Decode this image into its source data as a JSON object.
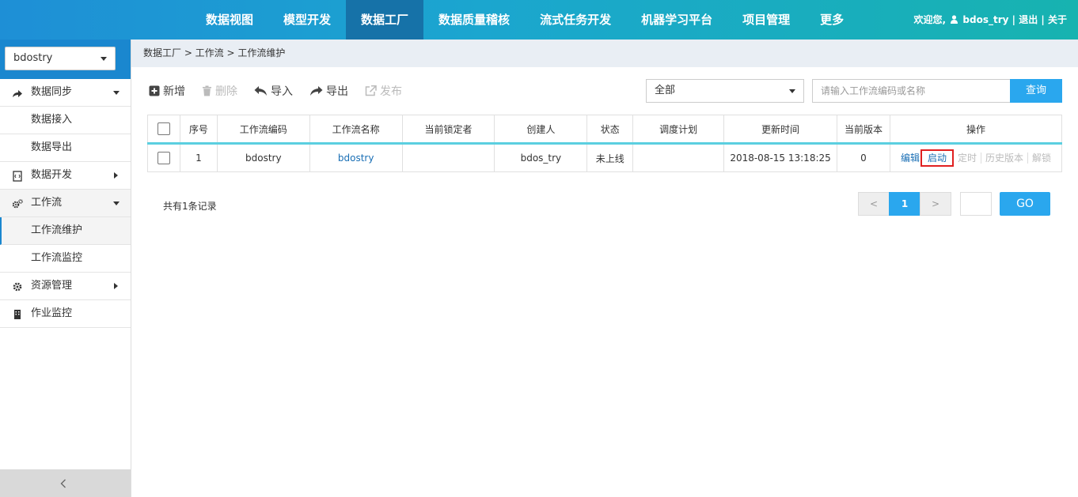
{
  "topnav": {
    "items": [
      "数据视图",
      "模型开发",
      "数据工厂",
      "数据质量稽核",
      "流式任务开发",
      "机器学习平台",
      "项目管理",
      "更多"
    ],
    "active_index": 2
  },
  "user": {
    "welcome": "欢迎您,",
    "name": "bdos_try",
    "logout": "退出",
    "about": "关于",
    "sep": "|"
  },
  "sidebar": {
    "project": "bdostry",
    "items": [
      {
        "label": "数据同步",
        "icon": "share-arrow-icon"
      },
      {
        "label": "数据接入"
      },
      {
        "label": "数据导出"
      },
      {
        "label": "数据开发",
        "icon": "code-file-icon"
      },
      {
        "label": "工作流",
        "icon": "gears-icon"
      },
      {
        "label": "工作流维护"
      },
      {
        "label": "工作流监控"
      },
      {
        "label": "资源管理",
        "icon": "gear-icon"
      },
      {
        "label": "作业监控",
        "icon": "building-icon"
      }
    ]
  },
  "breadcrumb": "数据工厂 > 工作流 > 工作流维护",
  "toolbar": {
    "add": "新增",
    "delete": "删除",
    "import": "导入",
    "export": "导出",
    "publish": "发布"
  },
  "filter": {
    "selected": "全部"
  },
  "search": {
    "placeholder": "请输入工作流编码或名称",
    "button": "查询"
  },
  "table": {
    "headers": [
      "序号",
      "工作流编码",
      "工作流名称",
      "当前锁定者",
      "创建人",
      "状态",
      "调度计划",
      "更新时间",
      "当前版本",
      "操作"
    ],
    "rows": [
      {
        "index": "1",
        "code": "bdostry",
        "name": "bdostry",
        "locker": "",
        "creator": "bdos_try",
        "status": "未上线",
        "schedule": "",
        "updated": "2018-08-15 13:18:25",
        "version": "0",
        "ops": {
          "edit": "编辑",
          "start": "启动",
          "timer": "定时",
          "history": "历史版本",
          "unlock": "解锁"
        }
      }
    ]
  },
  "footer": {
    "record_count": "共有1条记录",
    "prev": "<",
    "page": "1",
    "next": ">",
    "go": "GO"
  },
  "colors": {
    "accent": "#2aa7ee",
    "nav_active": "#1672a8",
    "highlight": "#e02020"
  }
}
